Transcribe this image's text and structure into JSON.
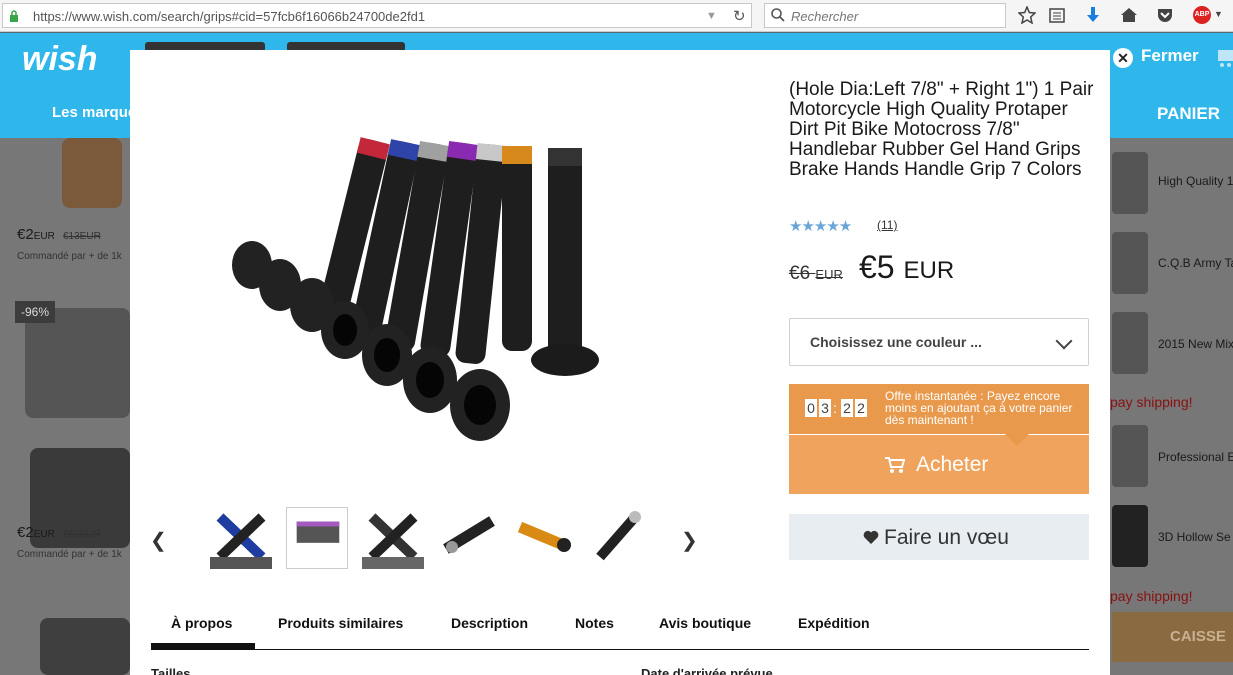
{
  "browser": {
    "url": "https://www.wish.com/search/grips#cid=57fcb6f16066b24700de2fd1",
    "search_placeholder": "Rechercher",
    "adblock_label": "ABP"
  },
  "background_page": {
    "logo": "wish",
    "nav_brands": "Les marque",
    "nav_cart": "PANIER",
    "left_products": [
      {
        "price": "€2",
        "currency": "EUR",
        "old_price": "€13EUR",
        "ordered": "Commandé par + de 1k"
      },
      {
        "badge": "-96%"
      },
      {
        "price": "€2",
        "currency": "EUR",
        "old_price": "€60EUR",
        "ordered": "Commandé par + de 1k"
      }
    ],
    "right_products": [
      {
        "label": "High Quality 1"
      },
      {
        "label": "C.Q.B Army Ta"
      },
      {
        "label": "2015 New Mix"
      },
      {
        "label": "Professional E"
      },
      {
        "label": "3D Hollow Se"
      }
    ],
    "ship_text_1": "pay shipping!",
    "ship_text_2": "pay shipping!",
    "checkout_label": "CAISSE"
  },
  "modal": {
    "close_label": "Fermer",
    "title": "(Hole Dia:Left 7/8\" + Right 1\") 1 Pair Motorcycle High Quality Protaper Dirt Pit Bike Motocross 7/8\" Handlebar Rubber Gel Hand Grips Brake Hands Handle Grip 7 Colors",
    "rating": 4.5,
    "stars": "★★★★★",
    "rating_count": "(11)",
    "old_price": "€6",
    "old_price_currency": "EUR",
    "price": "€5",
    "price_currency": "EUR",
    "color_select_placeholder": "Choisissez une couleur ...",
    "timer": {
      "d1": "0",
      "d2": "3",
      "d3": "2",
      "d4": "2"
    },
    "offer_text": "Offre instantanée : Payez encore moins en ajoutant ça à votre panier dès maintenant !",
    "buy_label": "Acheter",
    "wishlist_label": "Faire un vœu",
    "tabs": [
      "À propos",
      "Produits similaires",
      "Description",
      "Notes",
      "Avis boutique",
      "Expédition"
    ],
    "active_tab": "À propos",
    "section_left": "Tailles",
    "section_right": "Date d'arrivée prévue",
    "colors": {
      "accent": "#e8994c",
      "buy": "#f0a35c",
      "wish_bg": "#e8edf2",
      "star": "#6aa5d8"
    }
  }
}
